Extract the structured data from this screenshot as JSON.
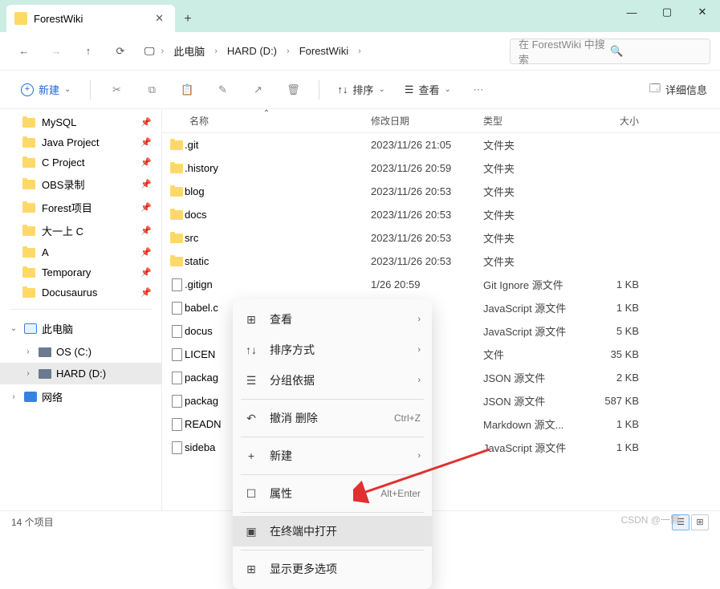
{
  "tab": {
    "title": "ForestWiki"
  },
  "breadcrumbs": [
    "此电脑",
    "HARD (D:)",
    "ForestWiki"
  ],
  "search": {
    "placeholder": "在 ForestWiki 中搜索"
  },
  "toolbar": {
    "new": "新建",
    "sort": "排序",
    "view": "查看",
    "details": "详细信息"
  },
  "sidebar": {
    "pinned": [
      "MySQL",
      "Java Project",
      "C Project",
      "OBS录制",
      "Forest项目",
      "大一上 C",
      "A",
      "Temporary",
      "Docusaurus"
    ],
    "thispc": "此电脑",
    "drives": [
      "OS (C:)",
      "HARD (D:)"
    ],
    "network": "网络"
  },
  "columns": {
    "name": "名称",
    "date": "修改日期",
    "type": "类型",
    "size": "大小"
  },
  "files": [
    {
      "name": ".git",
      "date": "2023/11/26 21:05",
      "type": "文件夹",
      "size": "",
      "kind": "folder"
    },
    {
      "name": ".history",
      "date": "2023/11/26 20:59",
      "type": "文件夹",
      "size": "",
      "kind": "folder"
    },
    {
      "name": "blog",
      "date": "2023/11/26 20:53",
      "type": "文件夹",
      "size": "",
      "kind": "folder"
    },
    {
      "name": "docs",
      "date": "2023/11/26 20:53",
      "type": "文件夹",
      "size": "",
      "kind": "folder"
    },
    {
      "name": "src",
      "date": "2023/11/26 20:53",
      "type": "文件夹",
      "size": "",
      "kind": "folder"
    },
    {
      "name": "static",
      "date": "2023/11/26 20:53",
      "type": "文件夹",
      "size": "",
      "kind": "folder"
    },
    {
      "name": ".gitign",
      "date": "1/26 20:59",
      "type": "Git Ignore 源文件",
      "size": "1 KB",
      "kind": "file"
    },
    {
      "name": "babel.c",
      "date": "1/26 20:53",
      "type": "JavaScript 源文件",
      "size": "1 KB",
      "kind": "file"
    },
    {
      "name": "docus",
      "date": "1/26 20:53",
      "type": "JavaScript 源文件",
      "size": "5 KB",
      "kind": "file"
    },
    {
      "name": "LICEN",
      "date": "1/26 20:53",
      "type": "文件",
      "size": "35 KB",
      "kind": "file"
    },
    {
      "name": "packag",
      "date": "1/26 20:53",
      "type": "JSON 源文件",
      "size": "2 KB",
      "kind": "file"
    },
    {
      "name": "packag",
      "date": "1/26 20:53",
      "type": "JSON 源文件",
      "size": "587 KB",
      "kind": "file"
    },
    {
      "name": "READN",
      "date": "1/26 20:53",
      "type": "Markdown 源文...",
      "size": "1 KB",
      "kind": "file"
    },
    {
      "name": "sideba",
      "date": "1/26 20:53",
      "type": "JavaScript 源文件",
      "size": "1 KB",
      "kind": "file"
    }
  ],
  "ctx": {
    "view": "查看",
    "sort": "排序方式",
    "group": "分组依据",
    "undo": "撤消 删除",
    "undo_key": "Ctrl+Z",
    "new": "新建",
    "props": "属性",
    "props_key": "Alt+Enter",
    "terminal": "在终端中打开",
    "more": "显示更多选项"
  },
  "status": {
    "count": "14 个项目"
  },
  "watermark": "CSDN @一颗"
}
